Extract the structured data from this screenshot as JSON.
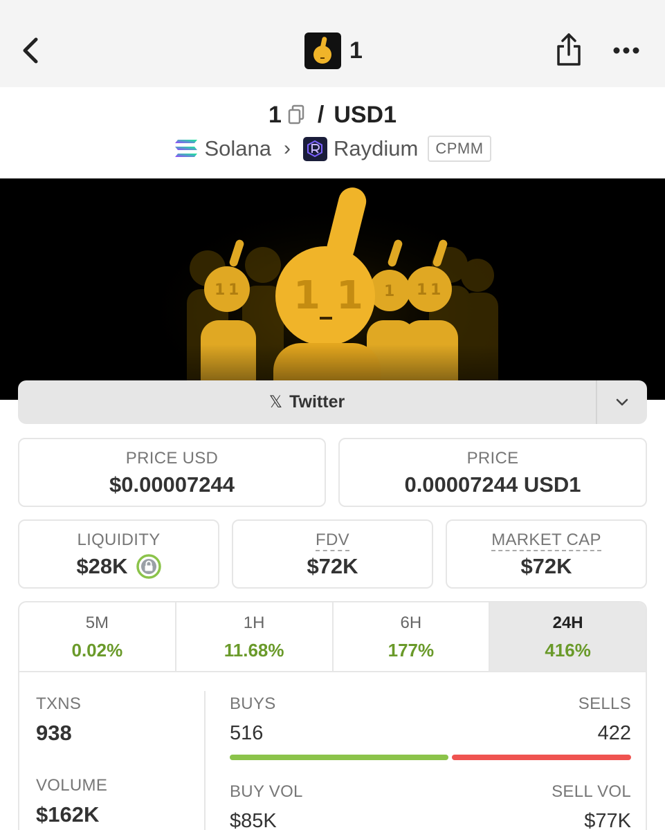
{
  "nav": {
    "title": "1"
  },
  "pair": {
    "base": "1",
    "separator": "/",
    "quote": "USD1",
    "chain": "Solana",
    "dex": "Raydium",
    "pool_type": "CPMM"
  },
  "social": {
    "label": "Twitter"
  },
  "prices": {
    "price_usd_label": "PRICE USD",
    "price_usd_value": "$0.00007244",
    "price_label": "PRICE",
    "price_value": "0.00007244 USD1"
  },
  "metrics": {
    "liquidity_label": "LIQUIDITY",
    "liquidity_value": "$28K",
    "fdv_label": "FDV",
    "fdv_value": "$72K",
    "mcap_label": "MARKET CAP",
    "mcap_value": "$72K"
  },
  "timeframes": [
    {
      "label": "5M",
      "change": "0.02%",
      "active": false
    },
    {
      "label": "1H",
      "change": "11.68%",
      "active": false
    },
    {
      "label": "6H",
      "change": "177%",
      "active": false
    },
    {
      "label": "24H",
      "change": "416%",
      "active": true
    }
  ],
  "stats": {
    "txns_label": "TXNS",
    "txns_value": "938",
    "buys_label": "BUYS",
    "buys_value": "516",
    "sells_label": "SELLS",
    "sells_value": "422",
    "volume_label": "VOLUME",
    "volume_value": "$162K",
    "buy_vol_label": "BUY VOL",
    "buy_vol_value": "$85K",
    "sell_vol_label": "SELL VOL",
    "sell_vol_value": "$77K"
  },
  "colors": {
    "positive": "#6a9a2a",
    "buys_bar": "#8bc34a",
    "sells_bar": "#ef5350",
    "coin_gold": "#f0b429"
  }
}
